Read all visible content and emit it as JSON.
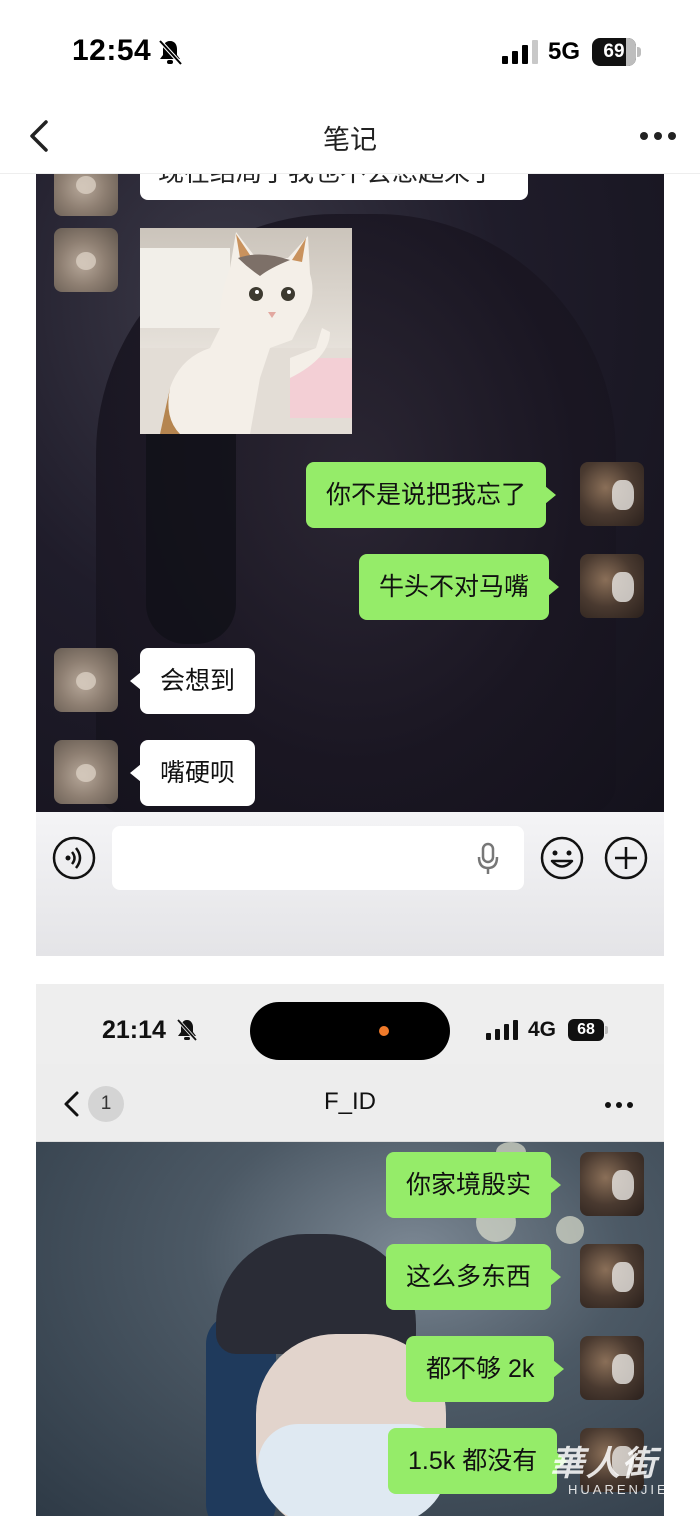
{
  "status_bar": {
    "time": "12:54",
    "network": "5G",
    "battery": "69"
  },
  "nav": {
    "title": "笔记"
  },
  "screenshot1": {
    "partial_message": "现在结局了我也不会想起来了",
    "messages": [
      {
        "side": "right",
        "text": "你不是说把我忘了"
      },
      {
        "side": "right",
        "text": "牛头不对马嘴"
      },
      {
        "side": "left",
        "text": "会想到"
      },
      {
        "side": "left",
        "text": "嘴硬呗"
      }
    ],
    "input_placeholder": ""
  },
  "screenshot2": {
    "status_bar": {
      "time": "21:14",
      "network": "4G",
      "battery": "68"
    },
    "nav": {
      "unread_count": "1",
      "title": "F_ID"
    },
    "messages": [
      {
        "side": "right",
        "text": "你家境殷实"
      },
      {
        "side": "right",
        "text": "这么多东西"
      },
      {
        "side": "right",
        "text": "都不够 2k"
      },
      {
        "side": "right",
        "text": "1.5k 都没有"
      }
    ]
  },
  "watermark": {
    "logo_text": "華人街",
    "sub_text": "HUARENJIE"
  },
  "colors": {
    "sent_bubble": "#95ec69",
    "received_bubble": "#ffffff",
    "nav_bg": "#ffffff"
  },
  "icons": [
    "muted-bell-icon",
    "signal-icon",
    "battery-icon",
    "back-chevron-icon",
    "more-dots-icon",
    "voice-input-icon",
    "microphone-icon",
    "emoji-icon",
    "plus-icon"
  ]
}
